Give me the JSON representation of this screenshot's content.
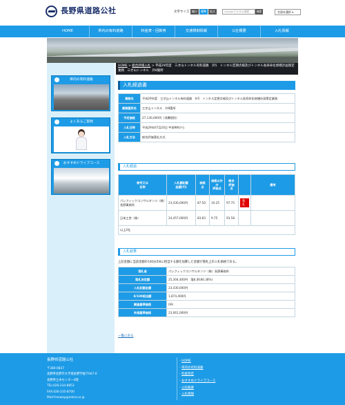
{
  "header": {
    "site_name": "長野県道路公社",
    "font_size_label": "文字サイズ",
    "font_sizes": [
      "縮小",
      "標準",
      "拡大"
    ],
    "search_placeholder": "Googleカスタム検索",
    "search_button": "検索",
    "language_select": "言語を選択"
  },
  "nav": [
    "HOME",
    "県内の有料道路",
    "料金表・回数券",
    "交通規制情報",
    "公社概要",
    "入札情報"
  ],
  "sidebar": {
    "banners": [
      "県内の有料道路",
      "よくあるご質問",
      "おすすめドライブコース"
    ]
  },
  "breadcrumb": {
    "home": "HOME",
    "parent": "総合評価入札",
    "sep": " > ",
    "current": "平成29年度　三才山トンネル有料道路　外5　トンネル定期点検及びトンネル長寿命化修繕計画策定業務　三才山トンネル　外8箇所"
  },
  "main": {
    "title": "入札経過書",
    "info_rows": [
      {
        "label": "業務名",
        "value": "平成29年度　三才山トンネル有料道路　外5　トンネル定期点検及びトンネル長寿命化修繕計画策定業務"
      },
      {
        "label": "業務箇所名",
        "value": "三才山トンネル　外8箇所"
      },
      {
        "label": "予定価格",
        "value": "27,130,000円（消費税別）"
      },
      {
        "label": "入札日時",
        "value": "平成29年07月20日 午前9時から"
      },
      {
        "label": "入札方法",
        "value": "総合評価落札方式"
      }
    ],
    "bid_section_title": "入札経過",
    "bid_headers": [
      "商号又は\n名称",
      "入札額記載\n金額(円)",
      "価格\n点",
      "価格以外\nの\n評価点",
      "総合\n評価\n点",
      "",
      "備考"
    ],
    "bid_rows": [
      {
        "name": "パシフィックコンサルタンツ（株）長野事務所",
        "amount": "23,430,000円",
        "price_pt": "87.50",
        "other_pt": "10.25",
        "total_pt": "97.75",
        "mark": "落札",
        "note": ""
      },
      {
        "name": "日本工営（株）",
        "amount": "24,457,000円",
        "price_pt": "83.83",
        "other_pt": "9.75",
        "total_pt": "93.58",
        "mark": "",
        "note": ""
      }
    ],
    "bid_footer": "以上2社",
    "result_section_title": "入札結果",
    "result_note": "上記金額に当該金額の100分の8に相当する額を加算した金額が落札上の入札価格である。",
    "result_rows": [
      {
        "label": "落札者",
        "value": "パシフィックコンサルタンツ（株）長野事務所"
      },
      {
        "label": "落札決定額",
        "value": "25,304,400円　落札率(86.38%)"
      },
      {
        "label": "入札記載金額",
        "value": "23,430,000円"
      },
      {
        "label": "8/100相当額",
        "value": "1,874,400円"
      },
      {
        "label": "調査基準価格",
        "value": "0円"
      },
      {
        "label": "失格基準価格",
        "value": "23,061,000円"
      }
    ],
    "back_link": "一覧に戻る"
  },
  "footer": {
    "name": "長野県道路公社",
    "info": [
      "〒380-0837",
      "長野県長野市大字南長野字幅下667-6",
      "長野県土木センター4階",
      "TEL:026-234-8853",
      "FAX:026-235-8700",
      "Mail:freeway@ndoro.or.jp"
    ],
    "links": [
      "HOME",
      "県内の有料道路",
      "料金改定",
      "おすすめドライブコース",
      "公社概要",
      "入札情報"
    ]
  },
  "colors": {
    "accent": "#1d9be6",
    "navy": "#1b2f6b",
    "award": "#e00000"
  }
}
